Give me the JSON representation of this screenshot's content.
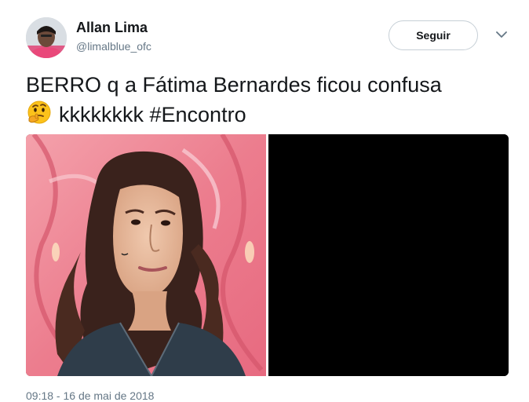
{
  "author": {
    "name": "Allan Lima",
    "handle": "@limalblue_ofc",
    "avatar_icon": "profile-photo"
  },
  "actions": {
    "follow_label": "Seguir",
    "more_icon": "chevron-down-icon"
  },
  "tweet": {
    "line1": "BERRO q a Fátima Bernardes ficou confusa",
    "line2_emoji": "thinking-face-emoji",
    "line2_text": "kkkkkkkk #Encontro",
    "timestamp": "09:18 - 16 de mai de 2018"
  },
  "media": {
    "images": [
      {
        "kind": "photo",
        "subject": "woman-confused"
      },
      {
        "kind": "photo",
        "subject": "black-image"
      }
    ]
  },
  "colors": {
    "text": "#14171a",
    "muted": "#657786",
    "button_border": "#c6cfd6",
    "background": "#ffffff"
  }
}
